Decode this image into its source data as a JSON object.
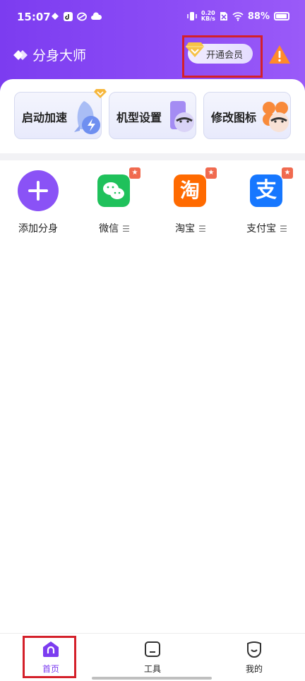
{
  "status_bar": {
    "time": "15:07",
    "net_speed_value": "0.20",
    "net_speed_unit": "KB/s",
    "battery": "88%"
  },
  "header": {
    "app_name": "分身大师",
    "vip_label": "开通会员"
  },
  "feature_cards": [
    {
      "label": "启动加速"
    },
    {
      "label": "机型设置"
    },
    {
      "label": "修改图标"
    }
  ],
  "apps": [
    {
      "label": "添加分身"
    },
    {
      "label": "微信",
      "menu": "☰"
    },
    {
      "label": "淘宝",
      "menu": "☰",
      "icon_text": "淘"
    },
    {
      "label": "支付宝",
      "menu": "☰",
      "icon_text": "支"
    }
  ],
  "bottom_nav": [
    {
      "label": "首页"
    },
    {
      "label": "工具"
    },
    {
      "label": "我的"
    }
  ],
  "colors": {
    "primary": "#7c3cf0",
    "wechat": "#1fc15b",
    "taobao": "#ff6a00",
    "alipay": "#1677ff",
    "badge": "#f06a4f",
    "highlight": "#d4202a"
  }
}
